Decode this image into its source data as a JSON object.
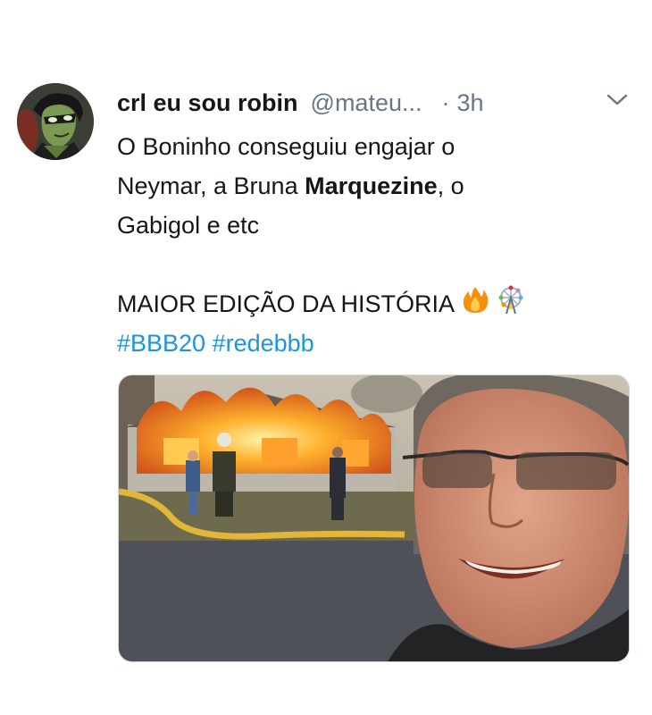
{
  "tweet": {
    "display_name": "crl eu sou robin",
    "handle": "@mateu...",
    "separator": "·",
    "time": "3h",
    "text": {
      "line1": "O Boninho conseguiu engajar o",
      "line2_a": "Neymar, a Bruna ",
      "line2_bold": "Marquezine",
      "line2_b": ", o",
      "line3": "Gabigol e etc",
      "line4": "MAIOR EDIÇÃO DA HISTÓRIA"
    },
    "hashtags": [
      "#BBB20",
      "#redebbb"
    ],
    "icons": {
      "avatar": "robin-cartoon-avatar",
      "caret": "chevron-down-icon",
      "emoji1": "fire-emoji",
      "emoji2": "ferris-wheel-emoji"
    },
    "colors": {
      "hashtag": "#1b95e0",
      "muted": "#657786",
      "text": "#14171a"
    }
  }
}
